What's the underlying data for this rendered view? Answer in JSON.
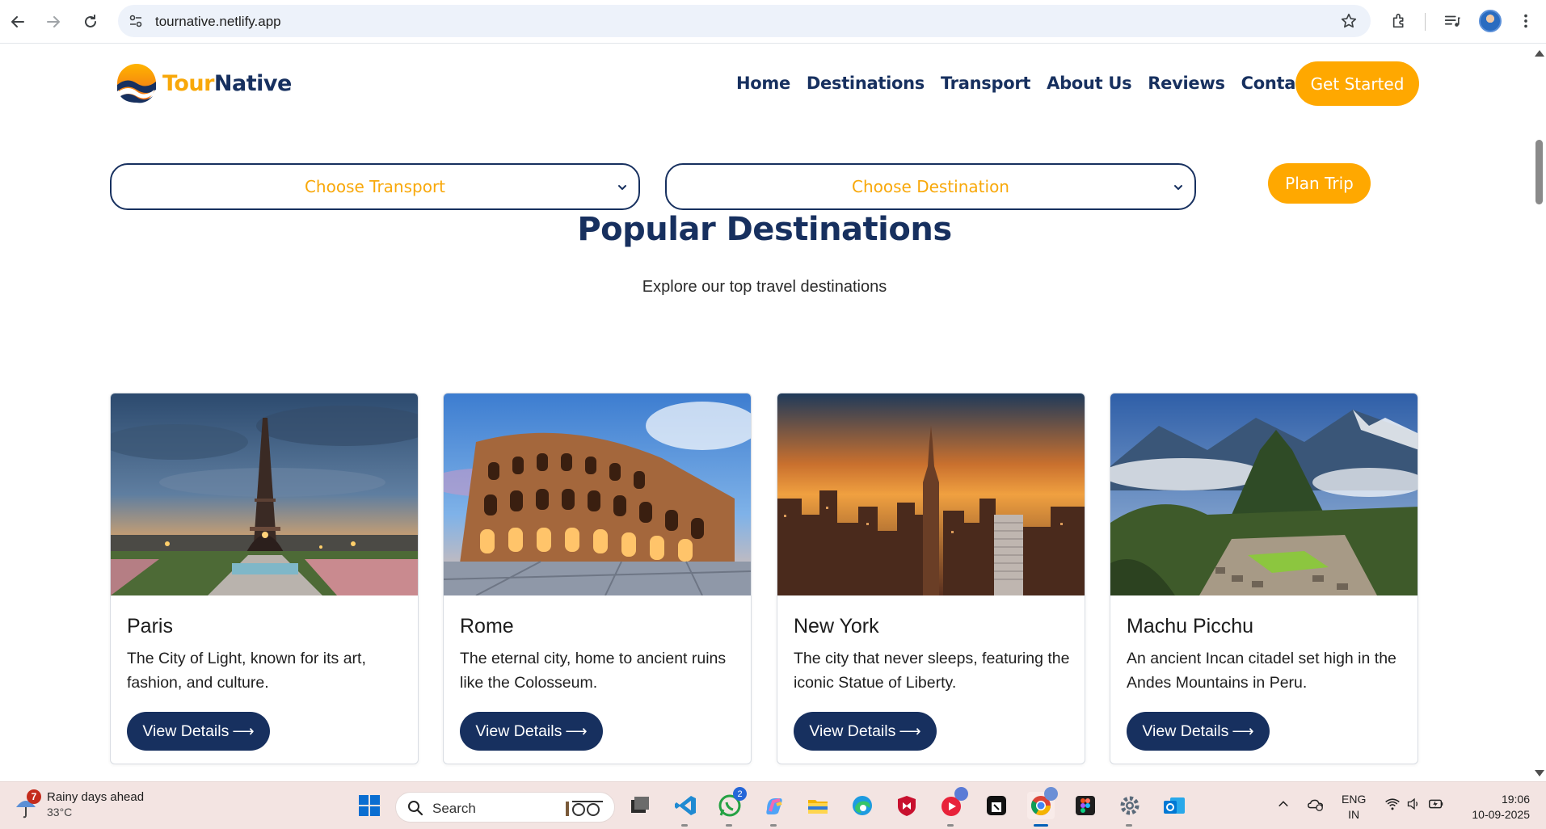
{
  "browser": {
    "url": "tournative.netlify.app"
  },
  "header": {
    "brand_part1": "Tour",
    "brand_part2": "Native",
    "nav": [
      "Home",
      "Destinations",
      "Transport",
      "About Us",
      "Reviews",
      "Contact Us"
    ],
    "cta": "Get Started"
  },
  "planner": {
    "transport_placeholder": "Choose Transport",
    "destination_placeholder": "Choose Destination",
    "plan_button": "Plan Trip"
  },
  "section": {
    "title": "Popular Destinations",
    "subtitle": "Explore our top travel destinations"
  },
  "cards": [
    {
      "title": "Paris",
      "desc": "The City of Light, known for its art, fashion, and culture.",
      "button": "View Details"
    },
    {
      "title": "Rome",
      "desc": "The eternal city, home to ancient ruins like the Colosseum.",
      "button": "View Details"
    },
    {
      "title": "New York",
      "desc": "The city that never sleeps, featuring the iconic Statue of Liberty.",
      "button": "View Details"
    },
    {
      "title": "Machu Picchu",
      "desc": "An ancient Incan citadel set high in the Andes Mountains in Peru.",
      "button": "View Details"
    }
  ],
  "taskbar": {
    "weather_badge": "7",
    "weather_text": "Rainy days ahead",
    "weather_temp": "33°C",
    "search_label": "Search",
    "whatsapp_badge": "2",
    "lang_line1": "ENG",
    "lang_line2": "IN",
    "time": "19:06",
    "date": "10-09-2025"
  },
  "colors": {
    "brand_navy": "#17305f",
    "brand_orange": "#ffa800"
  }
}
